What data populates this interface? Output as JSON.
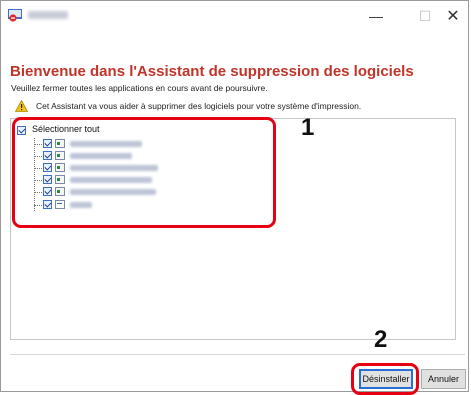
{
  "window": {
    "minimize_glyph": "—",
    "maximize_glyph": "☐",
    "close_glyph": "✕",
    "app_icon": "uninstall-app-icon"
  },
  "wizard": {
    "heading": "Bienvenue dans l'Assistant de suppression des logiciels",
    "subheading": "Veuillez fermer toutes les applications en cours avant de poursuivre.",
    "info_icon": "warning-info-icon",
    "info_text": "Cet Assistant va vous aider à supprimer des logiciels pour votre système d'impression."
  },
  "list": {
    "select_all_label": "Sélectionner tout",
    "select_all_checked": true,
    "items": [
      {
        "checked": true,
        "icon": "package-icon"
      },
      {
        "checked": true,
        "icon": "package-icon"
      },
      {
        "checked": true,
        "icon": "package-icon"
      },
      {
        "checked": true,
        "icon": "package-icon"
      },
      {
        "checked": true,
        "icon": "package-icon"
      },
      {
        "checked": true,
        "icon": "document-icon"
      }
    ]
  },
  "annotations": {
    "step1": "1",
    "step2": "2",
    "highlight_color": "#e60012"
  },
  "buttons": {
    "uninstall_label": "Désinstaller",
    "cancel_label": "Annuler"
  },
  "colors": {
    "heading": "#c0352a",
    "accent_blue": "#2a6fd6"
  }
}
